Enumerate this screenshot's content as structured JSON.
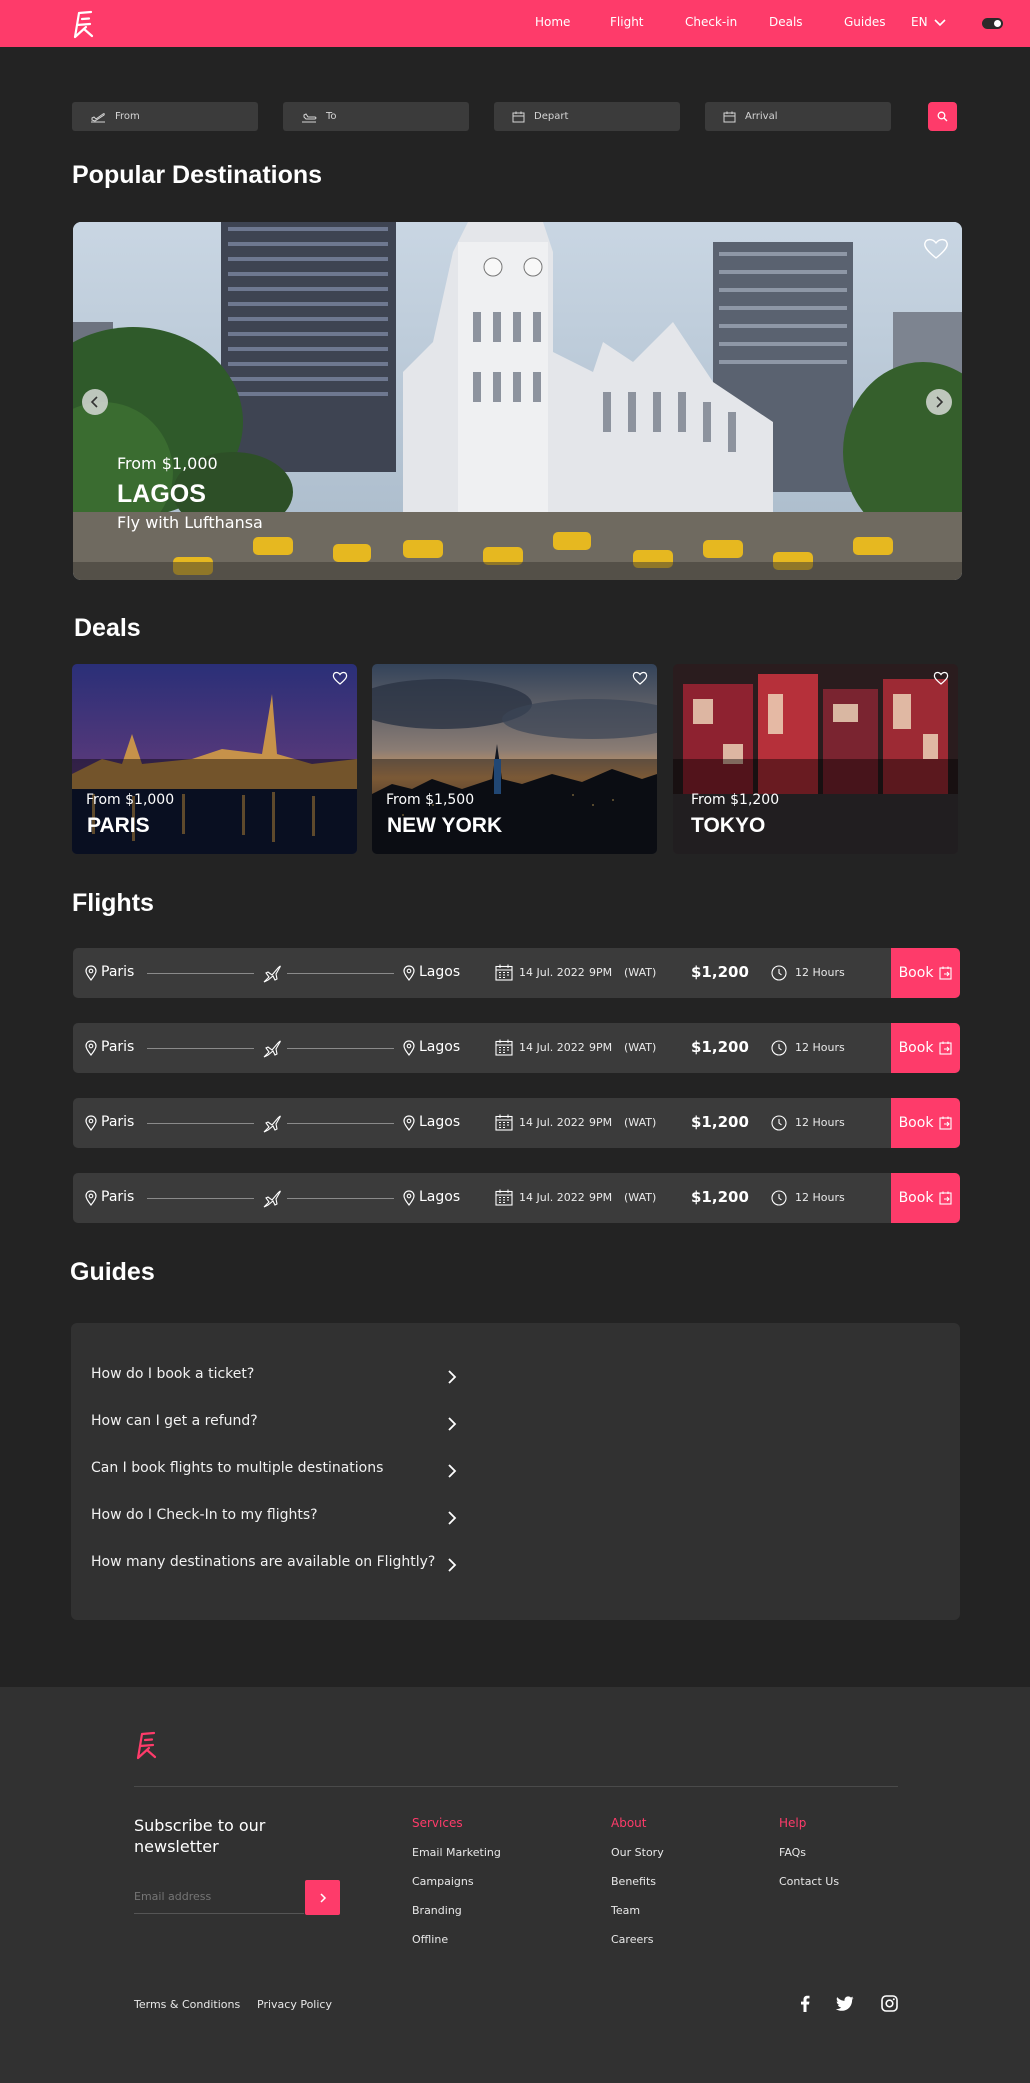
{
  "colors": {
    "accent": "#fe3b6a",
    "background": "#232323",
    "card": "#3b3b3b",
    "panel": "#313131"
  },
  "header": {
    "logo_icon": "flightly-logo",
    "nav": [
      "Home",
      "Flight",
      "Check-in",
      "Deals",
      "Guides"
    ],
    "language": "EN",
    "theme_toggle": "dark-mode-toggle"
  },
  "search": {
    "from": "From",
    "to": "To",
    "depart": "Depart",
    "arrival": "Arrival",
    "button_icon": "search-icon"
  },
  "popular": {
    "title": "Popular Destinations",
    "slide": {
      "price": "From $1,000",
      "city": "LAGOS",
      "airline": "Fly with Lufthansa"
    }
  },
  "deals": {
    "title": "Deals",
    "items": [
      {
        "price": "From $1,000",
        "city": "PARIS"
      },
      {
        "price": "From $1,500",
        "city": "NEW YORK"
      },
      {
        "price": "From $1,200",
        "city": "TOKYO"
      }
    ]
  },
  "flights": {
    "title": "Flights",
    "rows": [
      {
        "from": "Paris",
        "to": "Lagos",
        "date": "14 Jul. 2022",
        "time": "9PM",
        "tz": "(WAT)",
        "price": "$1,200",
        "duration": "12 Hours",
        "book": "Book"
      },
      {
        "from": "Paris",
        "to": "Lagos",
        "date": "14 Jul. 2022",
        "time": "9PM",
        "tz": "(WAT)",
        "price": "$1,200",
        "duration": "12 Hours",
        "book": "Book"
      },
      {
        "from": "Paris",
        "to": "Lagos",
        "date": "14 Jul. 2022",
        "time": "9PM",
        "tz": "(WAT)",
        "price": "$1,200",
        "duration": "12 Hours",
        "book": "Book"
      },
      {
        "from": "Paris",
        "to": "Lagos",
        "date": "14 Jul. 2022",
        "time": "9PM",
        "tz": "(WAT)",
        "price": "$1,200",
        "duration": "12 Hours",
        "book": "Book"
      }
    ]
  },
  "guides": {
    "title": "Guides",
    "questions": [
      "How do I book a ticket?",
      "How can I get a refund?",
      "Can I book flights to multiple destinations",
      "How do I Check-In to my flights?",
      "How many destinations are available on Flightly?"
    ]
  },
  "footer": {
    "newsletter": {
      "title_line1": "Subscribe to our",
      "title_line2": "newsletter",
      "placeholder": "Email address"
    },
    "columns": [
      {
        "heading": "Services",
        "links": [
          "Email Marketing",
          "Campaigns",
          "Branding",
          "Offline"
        ]
      },
      {
        "heading": "About",
        "links": [
          "Our Story",
          "Benefits",
          "Team",
          "Careers"
        ]
      },
      {
        "heading": "Help",
        "links": [
          "FAQs",
          "Contact Us"
        ]
      }
    ],
    "legal": [
      "Terms & Conditions",
      "Privacy Policy"
    ],
    "social": [
      "facebook-icon",
      "twitter-icon",
      "instagram-icon"
    ]
  }
}
